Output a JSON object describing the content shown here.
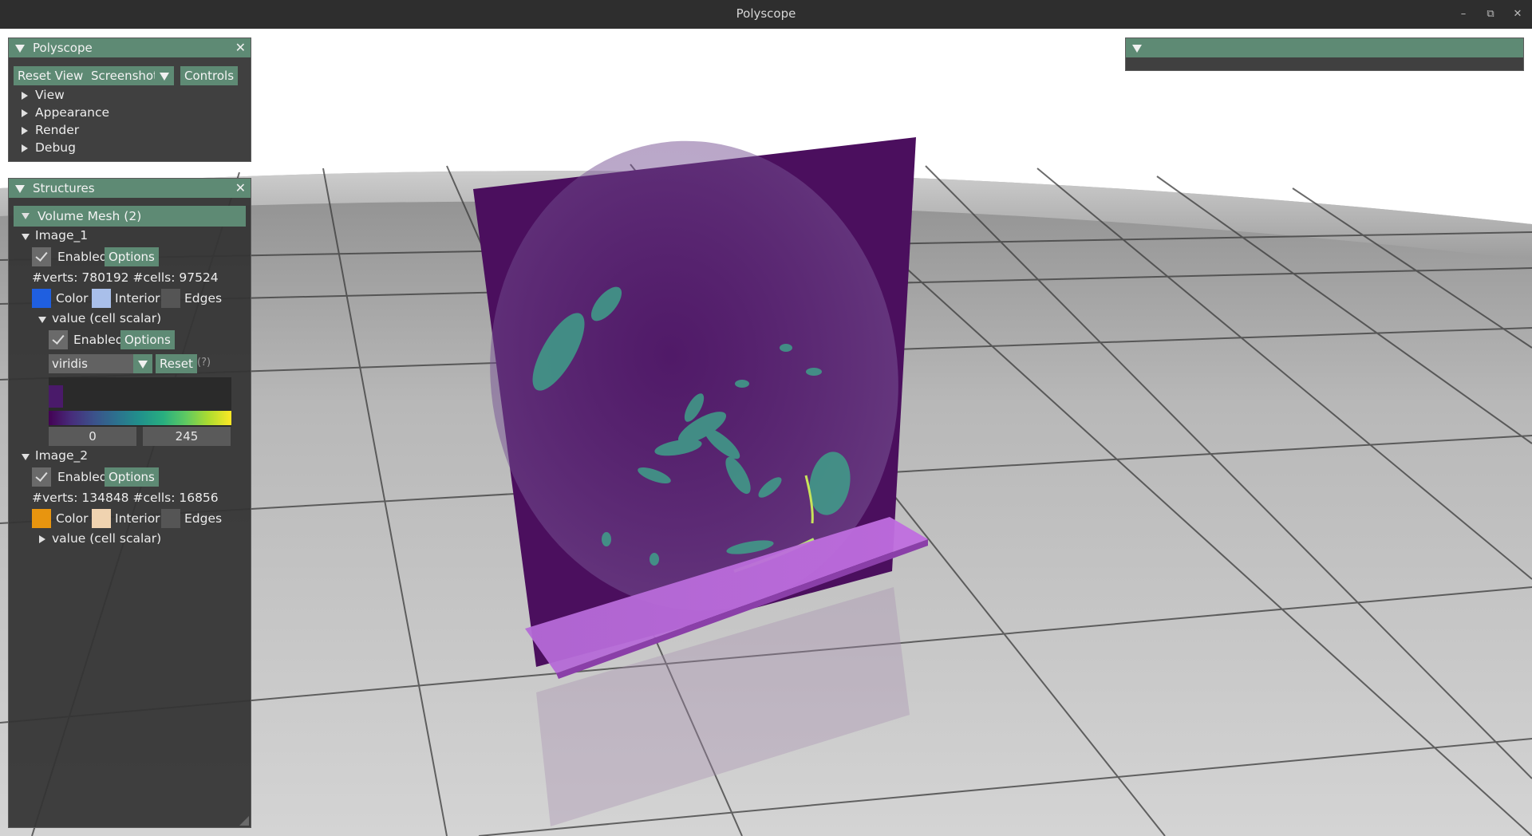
{
  "window": {
    "title": "Polyscope",
    "minimize_icon": "minimize-icon",
    "maximize_icon": "maximize-icon",
    "close_icon": "close-icon"
  },
  "polyscope_panel": {
    "title": "Polyscope",
    "buttons": {
      "reset_view": "Reset View",
      "screenshot": "Screenshot",
      "controls": "Controls"
    },
    "menu": [
      "View",
      "Appearance",
      "Render",
      "Debug"
    ]
  },
  "structures_panel": {
    "title": "Structures",
    "group_header": "Volume Mesh (2)",
    "image_1": {
      "name": "Image_1",
      "enabled_label": "Enabled",
      "options_label": "Options",
      "stats": "#verts: 780192  #cells: 97524",
      "color_label": "Color",
      "interior_label": "Interior",
      "edges_label": "Edges",
      "colors": {
        "color": "#1f5fe0",
        "interior": "#a9bfea",
        "edges": "#555555"
      },
      "quantity": {
        "name": "value (cell scalar)",
        "enabled_label": "Enabled",
        "options_label": "Options",
        "colormap": "viridis",
        "reset_label": "Reset",
        "help_label": "(?)",
        "range_min": "0",
        "range_max": "245"
      }
    },
    "image_2": {
      "name": "Image_2",
      "enabled_label": "Enabled",
      "options_label": "Options",
      "stats": "#verts: 134848  #cells: 16856",
      "color_label": "Color",
      "interior_label": "Interior",
      "edges_label": "Edges",
      "colors": {
        "color": "#e8950f",
        "interior": "#f0d3b0",
        "edges": "#555555"
      },
      "quantity": {
        "name": "value (cell scalar)"
      }
    }
  },
  "selection_panel": {
    "title": ""
  },
  "colors": {
    "accent": "#5e8a74",
    "panel_bg": "#343434",
    "slice_purple": "#4b0f5e",
    "base_pink": "#b05ad0"
  }
}
